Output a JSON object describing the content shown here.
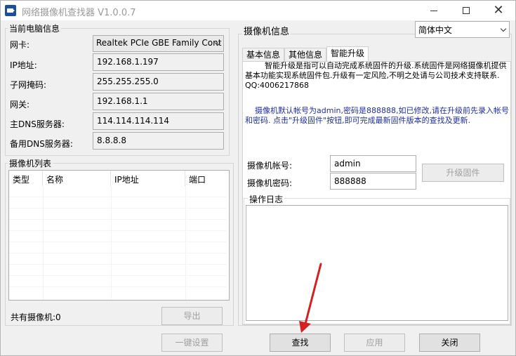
{
  "window": {
    "title": "网络摄像机查找器 V1.0.0.7",
    "controls": {
      "minimize": "—",
      "maximize": "☐",
      "close": "✕"
    }
  },
  "pc_info": {
    "group_label": "当前电脑信息",
    "nic_label": "网卡:",
    "nic_value": "Realtek PCIe GBE Family Cont",
    "ip_label": "IP地址:",
    "ip_value": "192.168.1.197",
    "mask_label": "子网掩码:",
    "mask_value": "255.255.255.0",
    "gateway_label": "网关:",
    "gateway_value": "192.168.1.1",
    "dns1_label": "主DNS服务器:",
    "dns1_value": "114.114.114.114",
    "dns2_label": "备用DNS服务器:",
    "dns2_value": "8.8.8.8"
  },
  "camera_list": {
    "group_label": "摄像机列表",
    "columns": [
      "类型",
      "名称",
      "IP地址",
      "端口"
    ],
    "count_label": "共有摄像机:0",
    "export_button": "导出",
    "one_key_button": "一键设置"
  },
  "camera_info": {
    "group_label": "摄像机信息",
    "language_value": "简体中文",
    "tabs": [
      "基本信息",
      "其他信息",
      "智能升级"
    ],
    "active_tab": "智能升级",
    "upgrade_desc": "智能升级是指可以自动完成系统固件的升级.系统固件是网络摄像机提供基本功能实现系统固件包.升级有一定风险,不明之处请与公司技术支持联系. QQ:4006217868",
    "upgrade_note": "摄像机默认帐号为admin,密码是888888,如已修改,请在升级前先录入帐号和密码. 点击\"升级固件\"按钮,即可完成最新固件版本的查找及更新.",
    "account_label": "摄像机帐号:",
    "account_value": "admin",
    "password_label": "摄像机密码:",
    "password_value": "888888",
    "upgrade_button": "升级固件",
    "log_label": "操作日志"
  },
  "footer": {
    "search_button": "查找",
    "apply_button": "应用",
    "close_button": "关闭"
  },
  "colors": {
    "note_text": "#1e2fa0",
    "arrow": "#d42020",
    "disabled_text": "#a0a0a0"
  }
}
